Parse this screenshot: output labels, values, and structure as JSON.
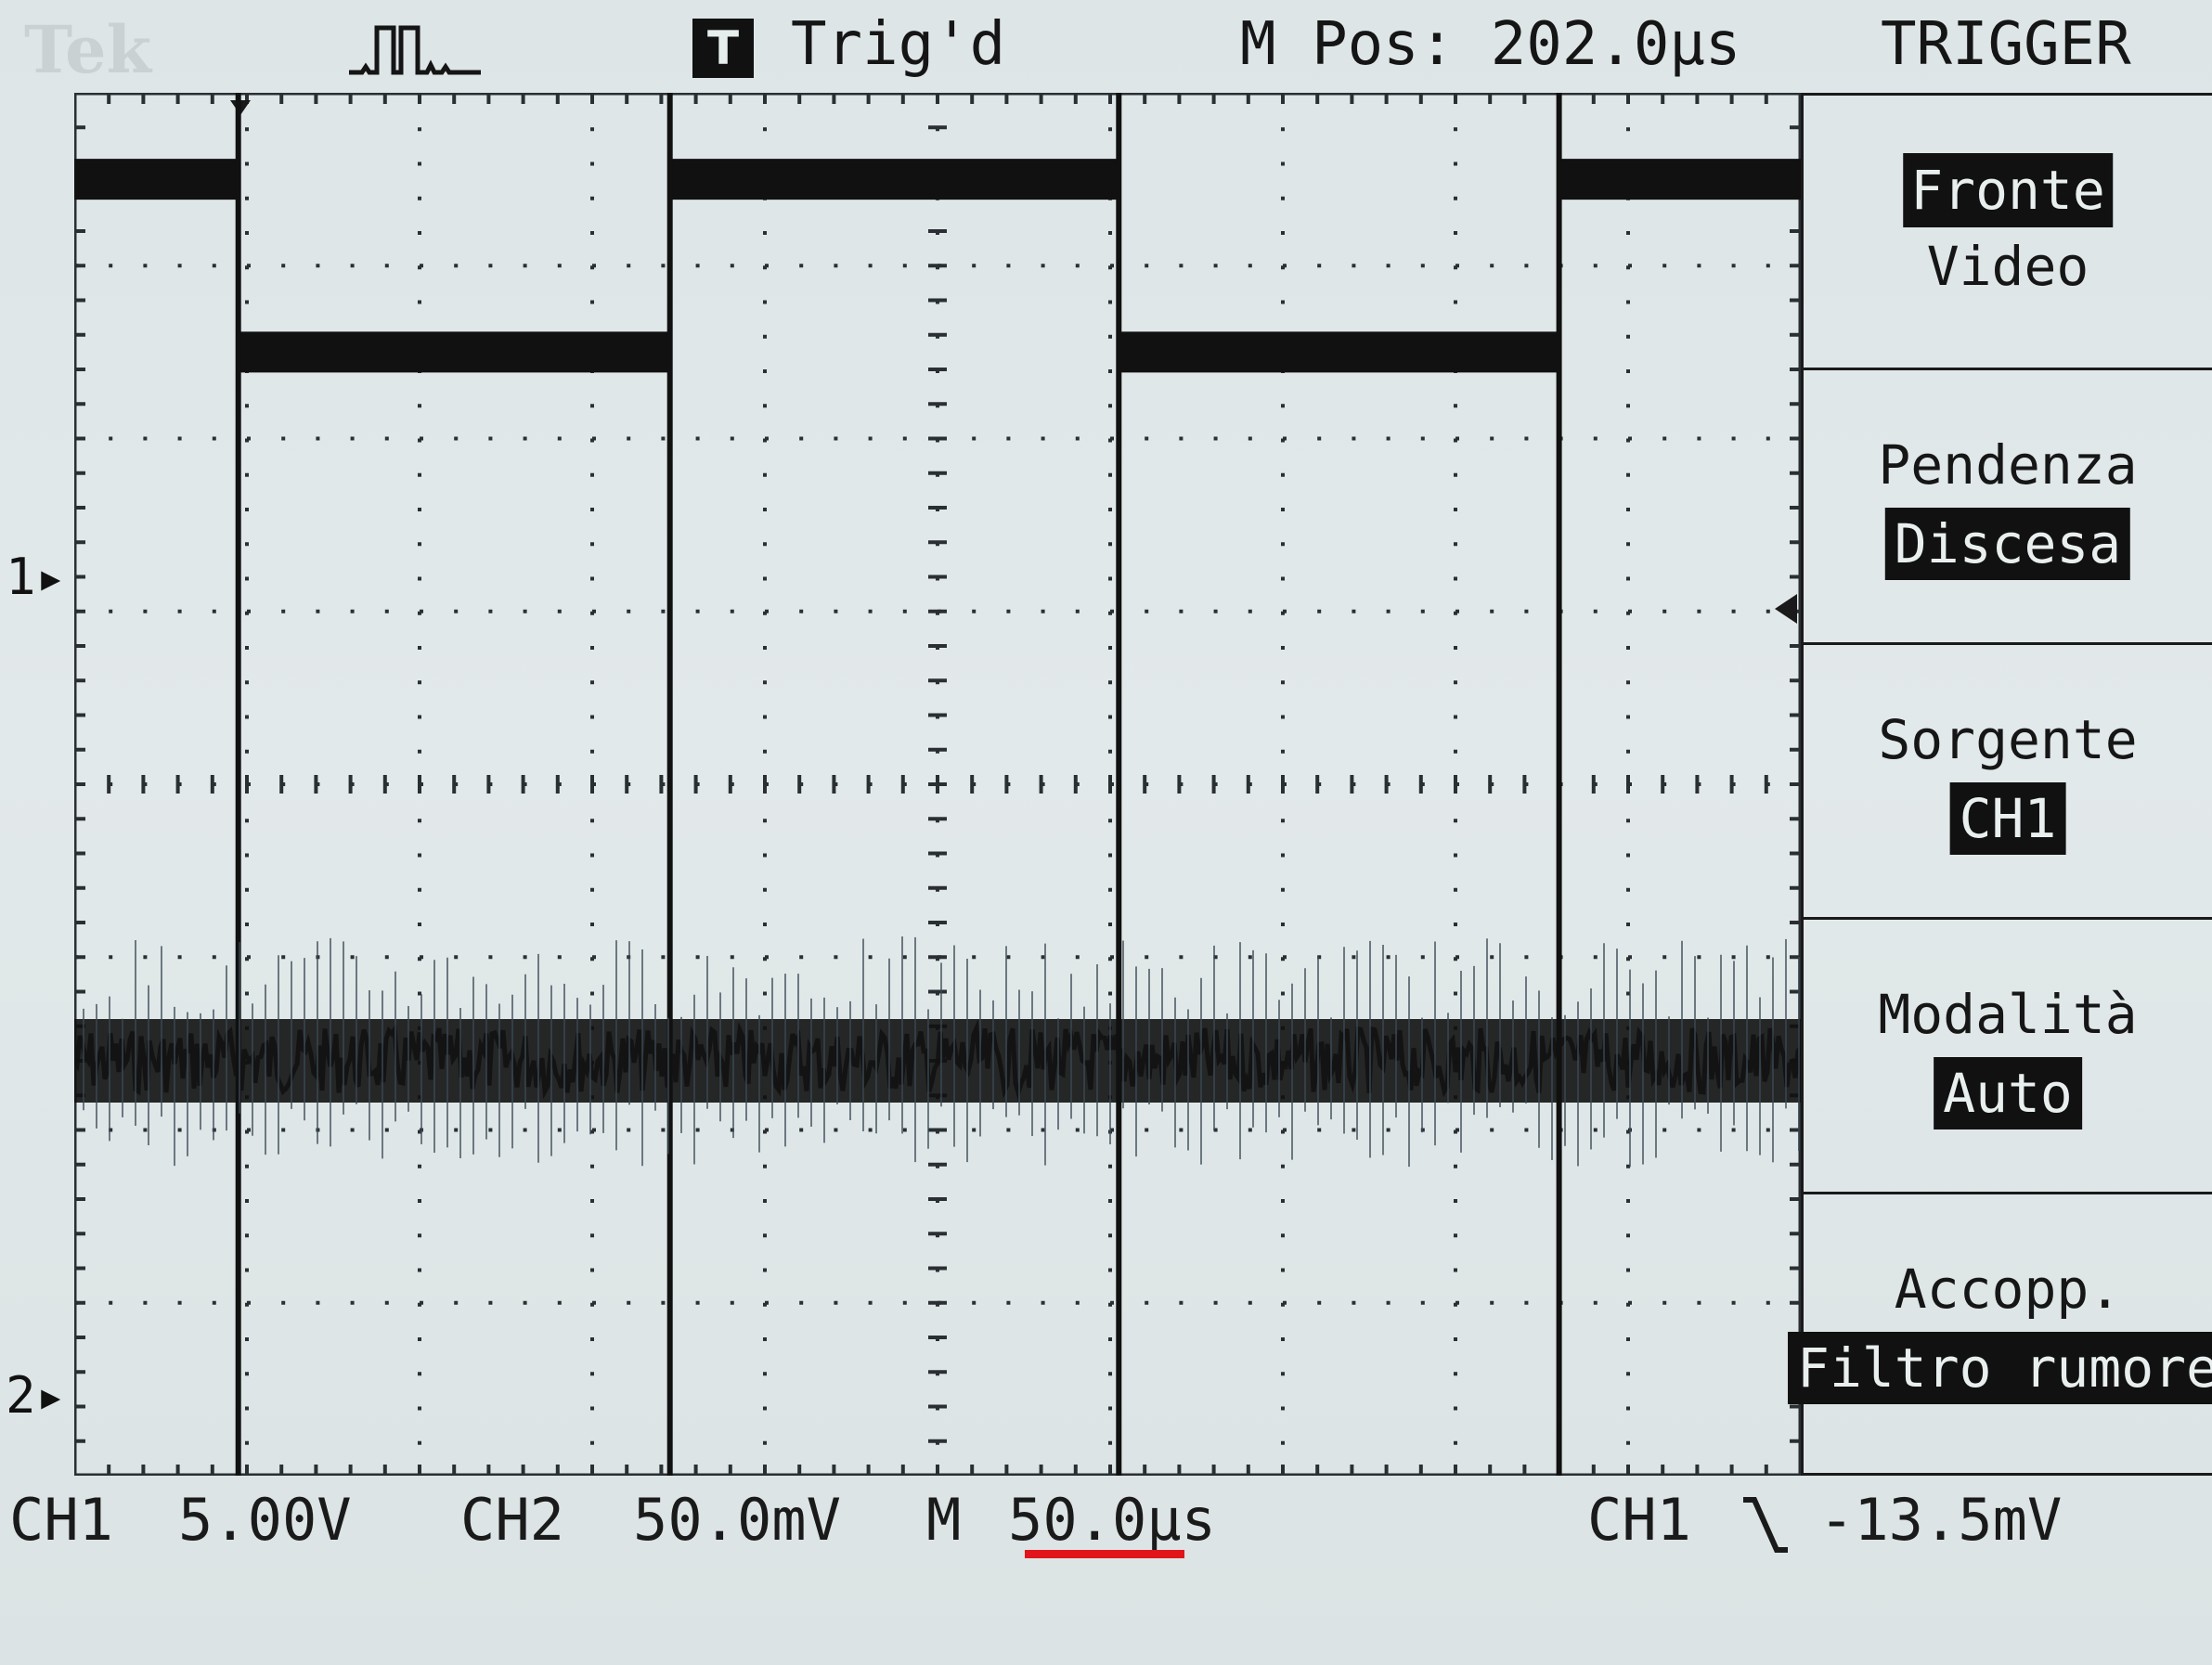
{
  "header": {
    "brand": "Tek",
    "acquisition_icon": "pulse-waveform-icon",
    "trigger_badge": "T",
    "trigger_status": "Trig'd",
    "main_position": "M Pos: 202.0µs",
    "menu_title": "TRIGGER"
  },
  "markers": {
    "ch1": "1",
    "ch2": "2"
  },
  "menu": {
    "tipo": {
      "selected": "Fronte",
      "other": "Video"
    },
    "items": [
      {
        "label": "Pendenza",
        "value": "Discesa"
      },
      {
        "label": "Sorgente",
        "value": "CH1"
      },
      {
        "label": "Modalità",
        "value": "Auto"
      },
      {
        "label": "Accopp.",
        "value": "Filtro rumore"
      }
    ]
  },
  "status": {
    "ch1_label": "CH1",
    "ch1_scale": "5.00V",
    "ch2_label": "CH2",
    "ch2_scale": "50.0mV",
    "time_label": "M",
    "time_scale": "50.0µs",
    "trigger_source": "CH1",
    "trigger_slope_icon": "falling-edge-icon",
    "trigger_level": "-13.5mV"
  },
  "colors": {
    "screen": "#dfe6e6",
    "trace": "#111111",
    "grid": "#2a2f33",
    "highlight_underline": "#e0141a"
  },
  "waveform": {
    "ch1": {
      "levels_div": [
        3.5,
        2.5
      ],
      "transitions_div": [
        0.95,
        3.45,
        6.05,
        8.6
      ],
      "start_level_div": 3.5
    },
    "ch2": {
      "level_div": -1.6,
      "noise": "high-frequency spikes"
    }
  }
}
